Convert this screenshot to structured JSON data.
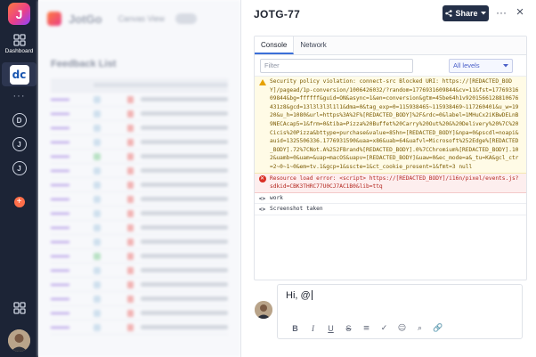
{
  "rail": {
    "logo_letter": "J",
    "dashboard_label": "Dashboard",
    "dc_badge": "dc",
    "more_dots": "···",
    "recent_letters": [
      "D",
      "J",
      "J"
    ],
    "plus_glyph": "+"
  },
  "background_app": {
    "brand": "JotGo",
    "canvas_view": "Canvas View",
    "list_title": "Feedback List"
  },
  "panel": {
    "title": "JOTG-77",
    "share_label": "Share",
    "more_glyph": "···",
    "close_glyph": "×"
  },
  "console": {
    "tabs": [
      {
        "label": "Console",
        "active": true
      },
      {
        "label": "Network",
        "active": false
      }
    ],
    "filter_placeholder": "Filter",
    "level_select": "All levels",
    "entries": [
      {
        "level": "warning",
        "text": "Security policy violation: connect-src Blocked URI: https://[REDACTED_BODY]/pagead/1p-conversion/1006426032/?random=1776931609844&cv=11&fst=1776931609844&bg=ffffff&guid=ON&async=1&en=conversion&gtm=45be64h1v9201566128810676431z8&gcd=13l3l3l3l1l1&dma=0&tag_exp=0=115938465~115938469~117260401&u_w=1920&u_h=1080&url=https%3A%2F%[REDACTED_BODY]%2F&rdc=0&label=1MHuCx2iKBwDELnB9NECAcap5=1&frm=0&tiba=Pizza%20Buffet%20Carry%20Out%20&%20Delivery%20%7C%20Cicis%20Pizza&bttype=purchase&value=85hn=[REDACTED_BODY]&npa=0&pscdl=noapi&auid=1325506336.1776931590&uaa=x86&uab=64&uafvl=Microsoft%252Edge%[REDACTED_BODY].72%7CNot.A%252FBrand%[REDACTED_BODY].0%7CChromium%[REDACTED_BODY].102&uamb=0&uam=&uap=macOS&uapv=[REDACTED_BODY]&uaw=0&ec_mode=a&_tu=KA&gcl_ctr=2~0~1~0&em=tv.1&gcp=1&sscte=1&ct_cookie_present=1&fmt=3 null"
      },
      {
        "level": "error",
        "text": "Resource load error: <script> https://[REDACTED_BODY]/i16n/pixel/events.js?sdkid=CBK3THRC77U0CJ7AC1B0&lib=ttq"
      },
      {
        "level": "log",
        "text": "work"
      },
      {
        "level": "log",
        "text": "Screenshot taken"
      }
    ]
  },
  "composer": {
    "text": "Hi, @",
    "toolbar": [
      "B",
      "I",
      "U",
      "S",
      "≡",
      "✓",
      "☺",
      "⌕",
      "🔗"
    ]
  },
  "colors": {
    "rail_bg": "#1c2436",
    "share_bg": "#243048",
    "tab_accent": "#3b6fd8",
    "warning_bg": "#fffbe6",
    "error_bg": "#fdeeee"
  }
}
